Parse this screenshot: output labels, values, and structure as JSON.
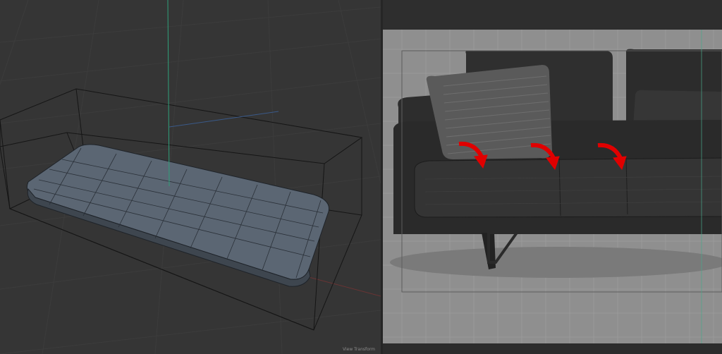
{
  "viewport_left": {
    "label": "3d-viewport",
    "hud_text": "View Transform",
    "object": "cushion-mesh"
  },
  "viewport_right": {
    "label": "reference-image-viewport",
    "subject": "sofa-reference-photo",
    "annotation_arrow_count": 3,
    "arrow_color": "#e00000"
  },
  "colors": {
    "viewport_bg": "#353535",
    "mesh_fill": "#5d6875",
    "y_axis": "#2fa07a",
    "x_axis": "#b03a3a",
    "reference_bg": "#8f8f8f",
    "sofa_leather": "#2b2b2b"
  }
}
